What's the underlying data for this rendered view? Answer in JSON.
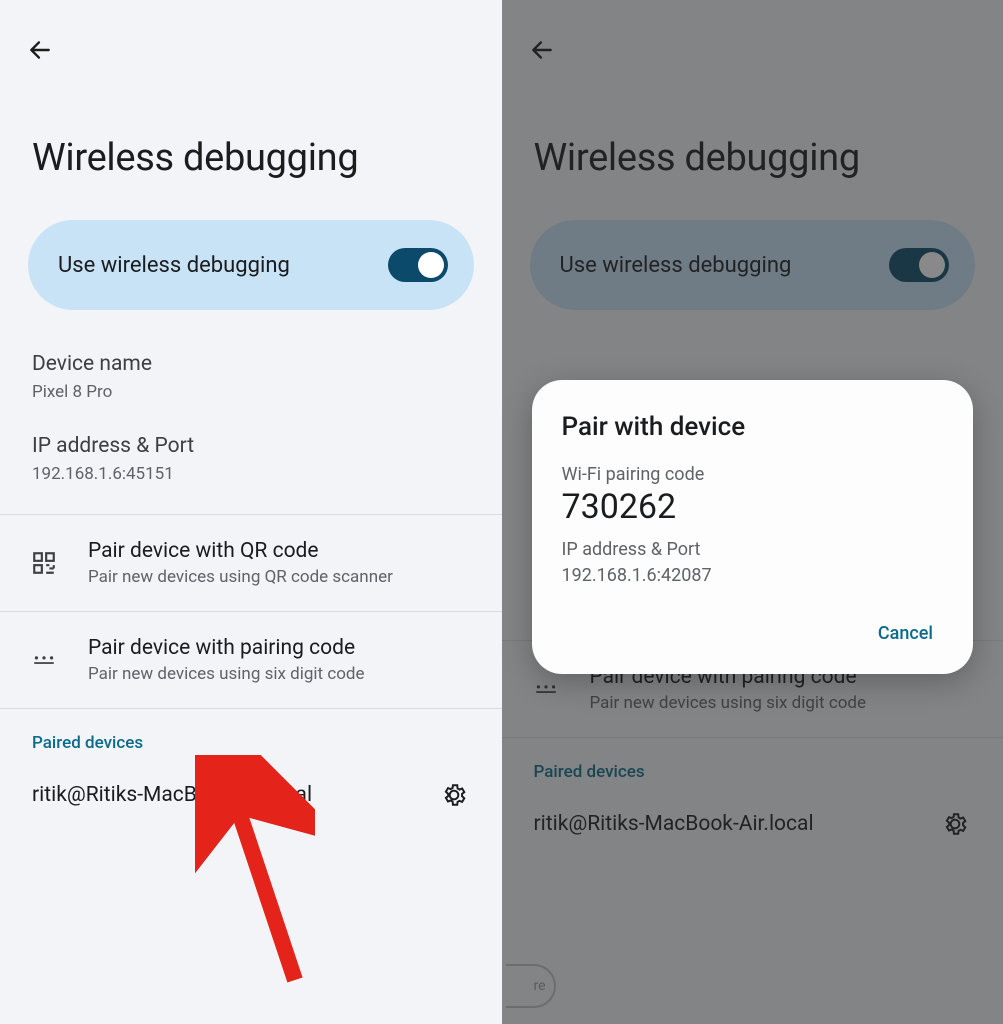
{
  "left": {
    "title": "Wireless debugging",
    "toggle_label": "Use wireless debugging",
    "device_name_label": "Device name",
    "device_name_value": "Pixel 8 Pro",
    "ip_label": "IP address & Port",
    "ip_value": "192.168.1.6:45151",
    "qr_option_title": "Pair device with QR code",
    "qr_option_sub": "Pair new devices using QR code scanner",
    "code_option_title": "Pair device with pairing code",
    "code_option_sub": "Pair new devices using six digit code",
    "paired_header": "Paired devices",
    "paired_device": "ritik@Ritiks-MacBook-Air.local"
  },
  "right": {
    "title": "Wireless debugging",
    "toggle_label": "Use wireless debugging",
    "code_option_title": "Pair device with pairing code",
    "code_option_sub": "Pair new devices using six digit code",
    "paired_header": "Paired devices",
    "paired_device": "ritik@Ritiks-MacBook-Air.local",
    "more_chip": "re"
  },
  "dialog": {
    "title": "Pair with device",
    "code_label": "Wi-Fi pairing code",
    "code_value": "730262",
    "ip_label": "IP address & Port",
    "ip_value": "192.168.1.6:42087",
    "cancel": "Cancel"
  }
}
